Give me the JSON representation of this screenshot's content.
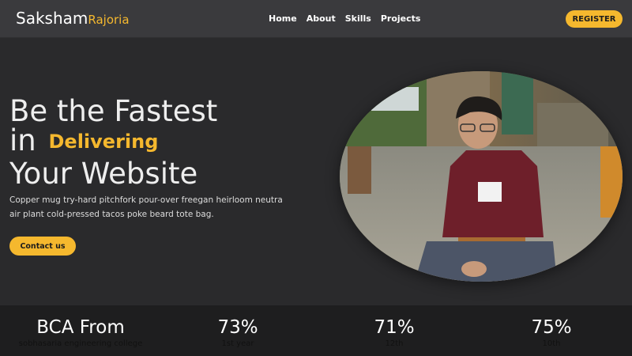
{
  "logo": {
    "first": "Saksham",
    "last": "Rajoria"
  },
  "nav": {
    "items": [
      "Home",
      "About",
      "Skills",
      "Projects"
    ],
    "register": "REGISTER"
  },
  "hero": {
    "line1": "Be the Fastest",
    "line2_prefix": "in",
    "line2_accent": "Delivering",
    "line3": "Your Website",
    "description": "Copper mug try-hard pitchfork pour-over freegan heirloom neutra air plant cold-pressed tacos poke beard tote bag.",
    "cta": "Contact us"
  },
  "stats": [
    {
      "value": "BCA From",
      "caption": "sobhasaria engineering college"
    },
    {
      "value": "73%",
      "caption": "1st year"
    },
    {
      "value": "71%",
      "caption": "12th"
    },
    {
      "value": "75%",
      "caption": "10th"
    }
  ],
  "colors": {
    "accent": "#f5b82e",
    "background": "#2a2a2c",
    "navbar": "#3a3a3d",
    "footer": "#1e1e1f"
  }
}
